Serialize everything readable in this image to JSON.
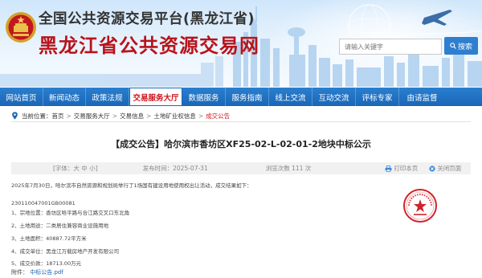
{
  "header": {
    "site_title": "全国公共资源交易平台(黑龙江省)",
    "site_name": "黑龙江省公共资源交易网",
    "search_placeholder": "请输入关键字",
    "search_button": "搜索"
  },
  "nav": {
    "items": [
      "网站首页",
      "新闻动态",
      "政策法规",
      "交易服务大厅",
      "数据服务",
      "服务指南",
      "线上交流",
      "互动交流",
      "评标专家",
      "由请监督"
    ],
    "active_index": 3
  },
  "breadcrumb": {
    "prefix": "当前位置：",
    "items": [
      "首页",
      "交易服务大厅",
      "交易信息",
      "土地矿业权信息",
      "成交公告"
    ]
  },
  "article": {
    "title": "【成交公告】哈尔滨市香坊区XF25-02-L-02-01-2地块中标公示",
    "font_size_label": "[字体：大 中 小]",
    "date": "发布时间：2025-07-31",
    "views": "浏览次数 111 次",
    "print": "打印本页",
    "close": "关闭页面",
    "intro": "2025年7月30日，哈尔滨市自然资源和规划局举行了1场国有建设用地使用权出让活动，成交结果如下：",
    "code": "230110047001GB00081",
    "lines": [
      "1、宗地位置：香坊区哈平路与合江路交叉口东北角",
      "2、土地用途：二类居住兼容商业设施用地",
      "3、土地面积：40887.72平方米",
      "4、成交单位：黑龙江万载房地产开发有限公司",
      "5、成交价款：18713.00万元"
    ],
    "attachment_label": "附件：",
    "attachment_file": "中标公告.pdf"
  },
  "colors": {
    "brand_red": "#b8131a",
    "nav_blue": "#1a66b8",
    "search_blue": "#2f7fd0"
  }
}
